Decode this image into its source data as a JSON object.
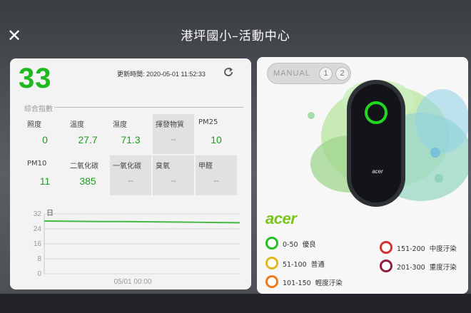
{
  "app": {
    "title": "港坪國小–活動中心",
    "close_glyph": "✕"
  },
  "summary": {
    "aqi_value": "33",
    "aqi_color": "#1fb81f",
    "updated": "更新時間: 2020-05-01 11:52:33",
    "aqi_label": "綜合指數"
  },
  "readings": [
    {
      "label": "照度",
      "value": "0",
      "status": "active"
    },
    {
      "label": "溫度",
      "value": "27.7",
      "status": "active"
    },
    {
      "label": "濕度",
      "value": "71.3",
      "status": "active"
    },
    {
      "label": "揮發物質",
      "value": "--",
      "status": "inactive"
    },
    {
      "label": "PM25",
      "value": "10",
      "status": "active"
    },
    {
      "label": "PM10",
      "value": "11",
      "status": "active"
    },
    {
      "label": "二氧化碳",
      "value": "385",
      "status": "active"
    },
    {
      "label": "一氧化碳",
      "value": "--",
      "status": "inactive"
    },
    {
      "label": "臭氧",
      "value": "--",
      "status": "inactive"
    },
    {
      "label": "甲醛",
      "value": "--",
      "status": "inactive"
    }
  ],
  "chart_data": {
    "type": "line",
    "title": "",
    "legend_label": "日",
    "xlabel": "",
    "ylabel": "",
    "x_tick_label": "05/01 00:00",
    "yticks": [
      "32",
      "24",
      "16",
      "8",
      "0"
    ],
    "ylim": [
      0,
      32
    ],
    "series": [
      {
        "name": "",
        "color": "#44b944",
        "x": [
          0,
          1,
          2,
          3,
          4,
          5,
          6,
          7,
          8,
          9,
          10
        ],
        "values": [
          28.2,
          28.1,
          28.0,
          27.9,
          27.9,
          27.8,
          27.7,
          27.6,
          27.5,
          27.4,
          27.3
        ]
      }
    ],
    "grid": true
  },
  "mode": {
    "label": "MANUAL",
    "buttons": [
      "1",
      "2"
    ]
  },
  "brand": {
    "name": "acer",
    "color": "#7ac51d"
  },
  "legend": [
    {
      "range": "0-50",
      "text": "優良",
      "color": "#1fc01f"
    },
    {
      "range": "51-100",
      "text": "普通",
      "color": "#e0b81a"
    },
    {
      "range": "101-150",
      "text": "輕度汙染",
      "color": "#f07a1a"
    },
    {
      "range": "151-200",
      "text": "中度汙染",
      "color": "#d83030"
    },
    {
      "range": "201-300",
      "text": "重度汙染",
      "color": "#8e1e3a"
    }
  ],
  "device": {
    "ring_color": "#1fd81f",
    "label": "acer"
  }
}
